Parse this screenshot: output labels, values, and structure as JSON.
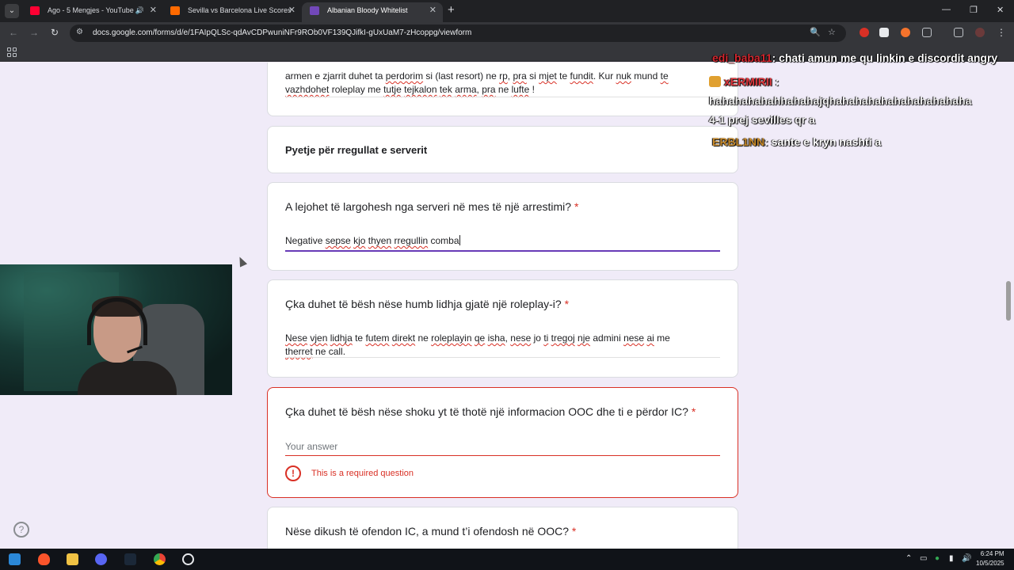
{
  "browser": {
    "tabs": [
      {
        "title": "Ago - 5 Mengjes - YouTube",
        "color": "#ff0033",
        "active": false
      },
      {
        "title": "Sevilla vs Barcelona Live Scores",
        "color": "#ff6a00",
        "active": false
      },
      {
        "title": "Albanian Bloody Whitelist",
        "color": "#7248b9",
        "active": true
      }
    ],
    "url": "docs.google.com/forms/d/e/1FAIpQLSc-qdAvCDPwuniNFr9ROb0VF139QJifkI-gUxUaM7-zHcoppg/viewform"
  },
  "form": {
    "prev_answer_line1_parts": [
      "armen e zjarrit duhet ta ",
      "perdorim",
      " si (last resort) ne ",
      "rp",
      ", ",
      "pra",
      " si ",
      "mjet",
      " te ",
      "fundit",
      ". Kur ",
      "nuk",
      " mund ",
      "te"
    ],
    "prev_answer_line2_parts": [
      "vazhdohet",
      " roleplay me ",
      "tutje",
      " ",
      "tejkalon",
      " ",
      "tek",
      " ",
      "arma",
      ", ",
      "pra",
      " ne ",
      "lufte",
      " !"
    ],
    "section_title": "Pyetje për rregullat e serverit",
    "q1": {
      "text": "A lejohet të largohesh nga serveri në mes të një arrestimi?",
      "required": "*",
      "answer_parts": [
        "Negative ",
        "sepse",
        " ",
        "kjo",
        " ",
        "thyen",
        " ",
        "rregullin",
        " ",
        "comba"
      ]
    },
    "q2": {
      "text": "Çka duhet të bësh nëse humb lidhja gjatë një roleplay-i?",
      "required": "*",
      "answer_line1_parts": [
        "Nese",
        " ",
        "vjen",
        " ",
        "lidhja",
        " te ",
        "futem",
        " ",
        "direkt",
        " ne ",
        "roleplayin",
        " ",
        "qe",
        " ",
        "isha",
        ", ",
        "nese",
        " jo ",
        "ti",
        " ",
        "tregoj",
        " ",
        "nje",
        " admini ",
        "nese",
        " ",
        "ai",
        " me"
      ],
      "answer_line2_parts": [
        "therret",
        " ne call."
      ]
    },
    "q3": {
      "text": "Çka duhet të bësh nëse shoku yt të thotë një informacion OOC dhe ti e përdor IC?",
      "required": "*",
      "placeholder": "Your answer",
      "error_icon": "!",
      "error": "This is a required question"
    },
    "q4": {
      "text": "Nëse dikush të ofendon IC, a mund t’i ofendosh në OOC?",
      "required": "*"
    },
    "help_icon": "?"
  },
  "chat": {
    "msg1": {
      "user": "edi_baba11",
      "user_color": "#d3262e",
      "text": ": chati amun me qu linkin e discordit angry"
    },
    "msg2": {
      "user": "xERMIRII",
      "user_color": "#e0383e",
      "text": ":",
      "body1": "hahahahahahhahahajqhahahahahahahahahahaha",
      "body2": "4-1 prej sevilles qr a"
    },
    "msg3": {
      "user": "ERBL1NN",
      "user_color": "#c78a2b",
      "text": ": sante e kryn nashti a"
    }
  },
  "taskbar": {
    "time": "6:24 PM",
    "date": "10/5/2025"
  }
}
